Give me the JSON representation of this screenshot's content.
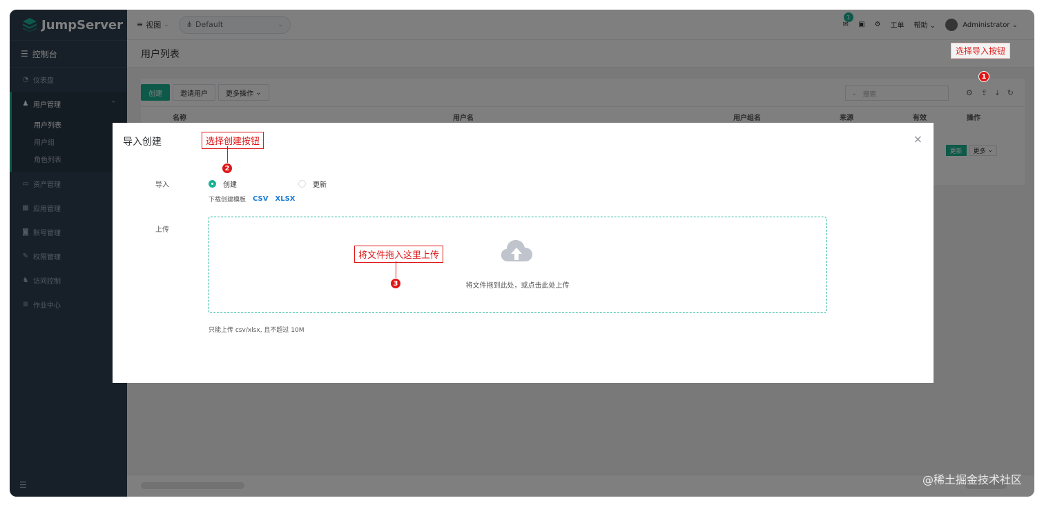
{
  "app": {
    "name": "JumpServer"
  },
  "sidebar": {
    "console": "控制台",
    "items": [
      {
        "label": "仪表盘",
        "icon": "dashboard-icon"
      },
      {
        "label": "用户管理",
        "icon": "users-icon",
        "expanded": true
      },
      {
        "label": "资产管理",
        "icon": "assets-icon"
      },
      {
        "label": "应用管理",
        "icon": "apps-icon"
      },
      {
        "label": "账号管理",
        "icon": "account-icon"
      },
      {
        "label": "权限管理",
        "icon": "permission-icon"
      },
      {
        "label": "访问控制",
        "icon": "access-control-icon"
      },
      {
        "label": "作业中心",
        "icon": "job-center-icon"
      }
    ],
    "user_sub": [
      {
        "label": "用户列表",
        "active": true
      },
      {
        "label": "用户组"
      },
      {
        "label": "角色列表"
      }
    ]
  },
  "topbar": {
    "view": "视图",
    "org": "Default",
    "message_count": "1",
    "ticket": "工单",
    "help": "帮助",
    "user": "Administrator"
  },
  "page": {
    "title": "用户列表",
    "toolbar": {
      "create": "创建",
      "invite": "邀请用户",
      "more": "更多操作"
    },
    "search_placeholder": "搜索",
    "columns": [
      "名称",
      "用户名",
      "用户组名",
      "来源",
      "有效",
      "操作"
    ],
    "row_actions": {
      "update": "更新",
      "more": "更多"
    }
  },
  "annotations": {
    "step1": {
      "num": "1",
      "text": "选择导入按钮"
    },
    "step2": {
      "num": "2",
      "text": "选择创建按钮"
    },
    "step3": {
      "num": "3",
      "text": "将文件拖入这里上传"
    }
  },
  "modal": {
    "title": "导入创建",
    "import_label": "导入",
    "radio_create": "创建",
    "radio_update": "更新",
    "template_text": "下载创建模板",
    "csv": "CSV",
    "xlsx": "XLSX",
    "upload_label": "上传",
    "upload_hint": "将文件拖到此处，或点击此处上传",
    "limit": "只能上传 csv/xlsx, 且不超过 10M",
    "close": "×"
  },
  "watermark": "@稀土掘金技术社区",
  "colors": {
    "brand": "#1ab394",
    "sidebar": "#2f4050",
    "annotation": "#e01616"
  }
}
